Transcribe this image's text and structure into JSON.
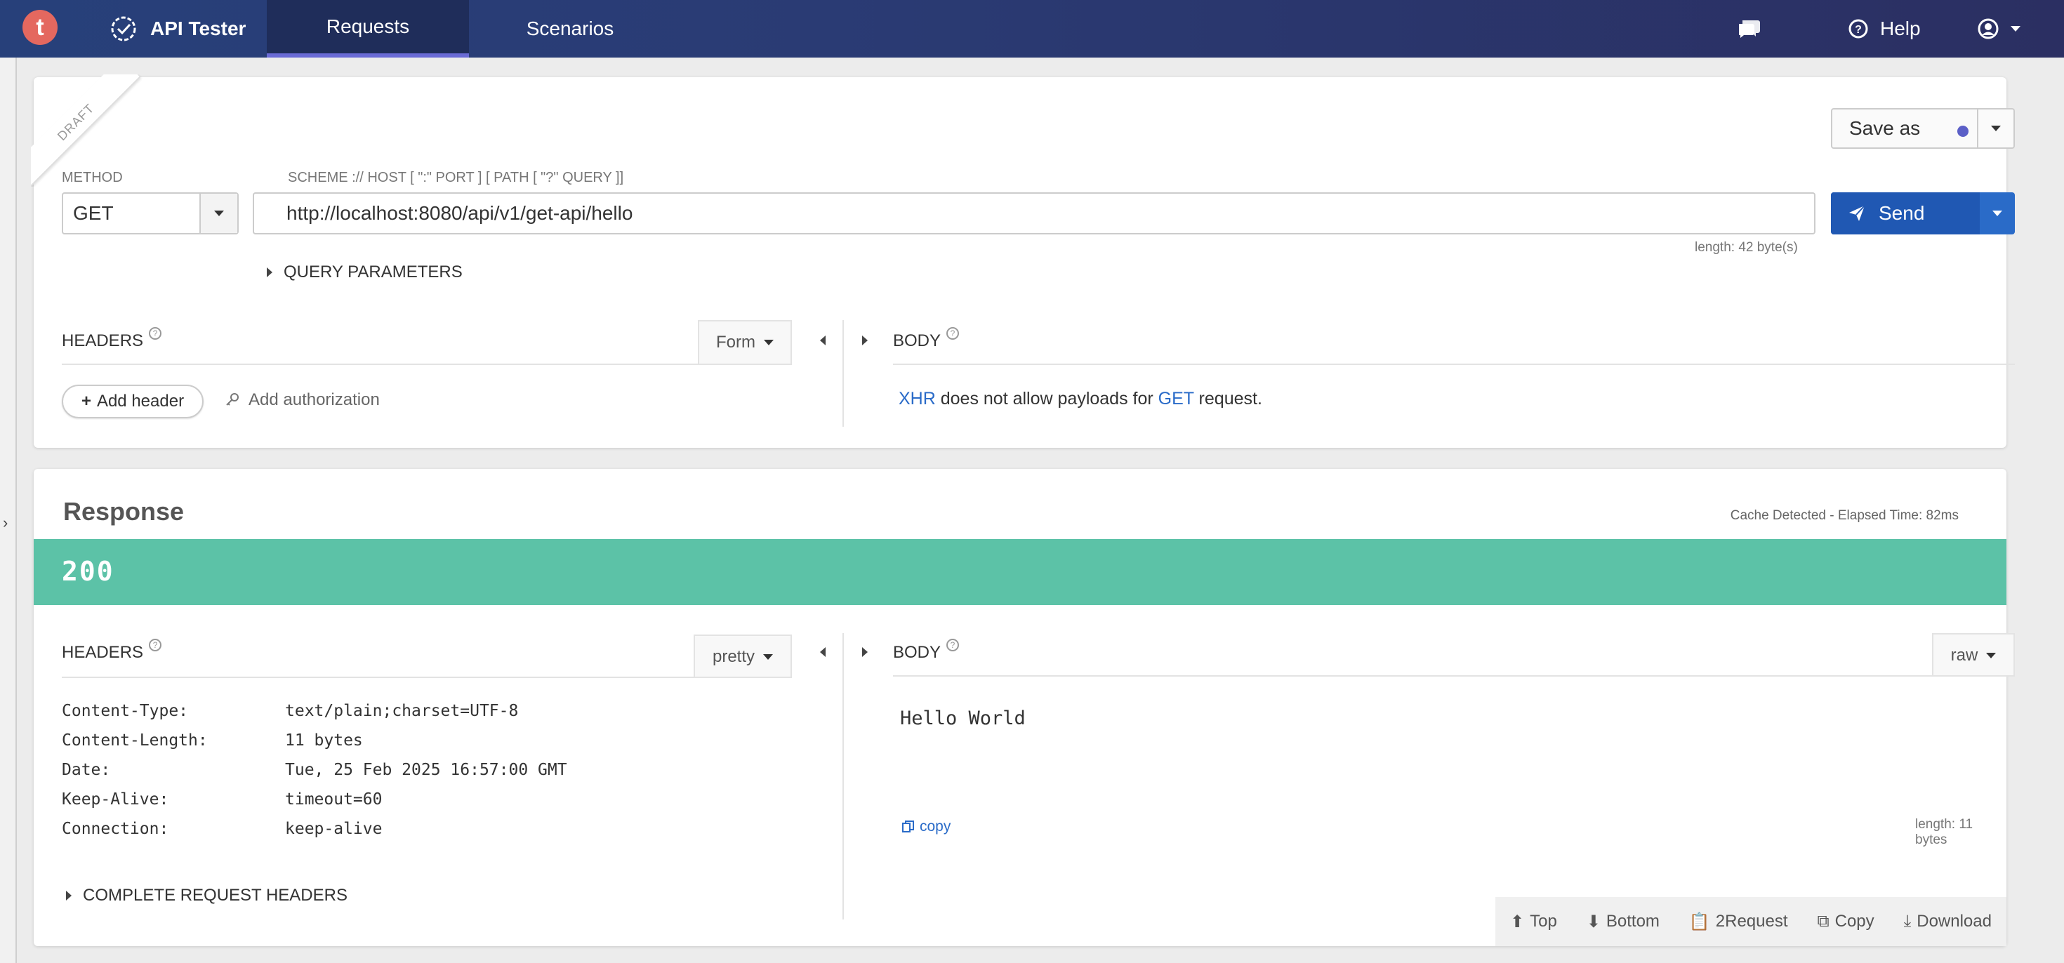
{
  "app": {
    "logo_letter": "t",
    "brand": "API Tester",
    "tabs": [
      {
        "label": "Requests",
        "active": true
      },
      {
        "label": "Scenarios",
        "active": false
      }
    ],
    "help_label": "Help",
    "icons": {
      "chat": "chat-icon",
      "help": "help-circle-icon",
      "account": "user-circle-icon"
    },
    "colors": {
      "accent": "#6a6bd6",
      "send": "#2058b3",
      "status_ok": "#5cc2a7",
      "logo": "#e4685f"
    }
  },
  "request": {
    "draft_label": "DRAFT",
    "method_label": "METHOD",
    "method_value": "GET",
    "url_label": "SCHEME :// HOST [ \":\" PORT ] [ PATH [ \"?\" QUERY ]]",
    "url_value": "http://localhost:8080/api/v1/get-api/hello",
    "url_length": "length: 42 byte(s)",
    "save_as": "Save as",
    "send": "Send",
    "query_parameters": "QUERY PARAMETERS",
    "headers_title": "HEADERS",
    "headers_mode": "Form",
    "add_header": "Add header",
    "add_authorization": "Add authorization",
    "body_title": "BODY",
    "body_note": {
      "xhr": "XHR",
      "middle": " does not allow payloads for ",
      "get": "GET",
      "end": " request."
    }
  },
  "response": {
    "title": "Response",
    "cache_note": "Cache Detected -  Elapsed Time: 82ms",
    "status_code": "200",
    "headers_title": "HEADERS",
    "headers_mode": "pretty",
    "body_title": "BODY",
    "body_mode": "raw",
    "headers": [
      {
        "key": "Content-Type:",
        "value": "text/plain;charset=UTF-8"
      },
      {
        "key": "Content-Length:",
        "value": "11 bytes"
      },
      {
        "key": "Date:",
        "value": "Tue, 25 Feb 2025 16:57:00 GMT"
      },
      {
        "key": "Keep-Alive:",
        "value": "timeout=60"
      },
      {
        "key": "Connection:",
        "value": "keep-alive"
      }
    ],
    "body_text": "Hello World",
    "copy": "copy",
    "body_length": "length: 11 bytes",
    "complete_request_headers": "COMPLETE REQUEST HEADERS",
    "toolbar": {
      "top": "Top",
      "bottom": "Bottom",
      "to_request": "2Request",
      "copy": "Copy",
      "download": "Download"
    }
  }
}
